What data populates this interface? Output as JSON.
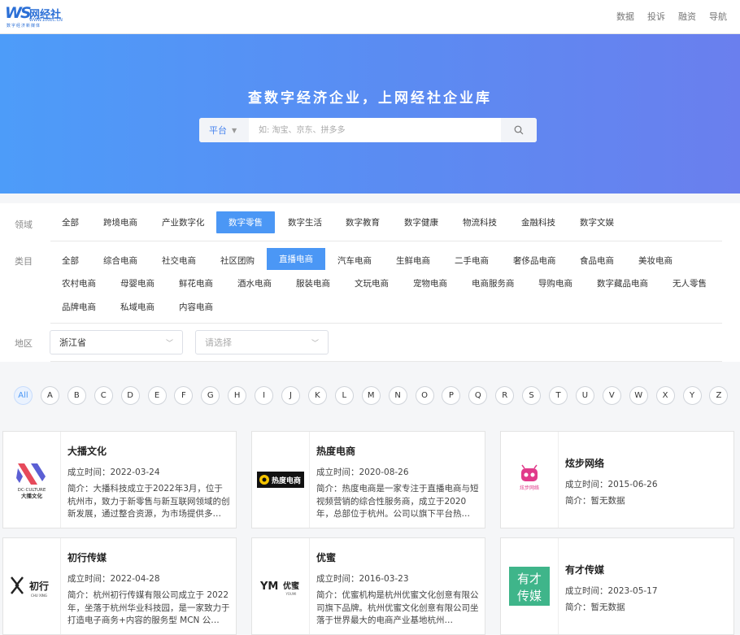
{
  "header": {
    "logo_mark": "WS",
    "logo_name": "网经社",
    "logo_url": "WWW.100EC.CN",
    "logo_tagline": "数字经济新媒体",
    "nav": [
      "数据",
      "投诉",
      "融资",
      "导航"
    ]
  },
  "hero": {
    "title": "查数字经济企业，上网经社企业库",
    "search_select": "平台",
    "search_placeholder": "如: 淘宝、京东、拼多多"
  },
  "filters": {
    "domain_label": "领域",
    "domains": [
      "全部",
      "跨境电商",
      "产业数字化",
      "数字零售",
      "数字生活",
      "数字教育",
      "数字健康",
      "物流科技",
      "金融科技",
      "数字文娱"
    ],
    "domain_active": "数字零售",
    "category_label": "类目",
    "categories": [
      "全部",
      "综合电商",
      "社交电商",
      "社区团购",
      "直播电商",
      "汽车电商",
      "生鲜电商",
      "二手电商",
      "奢侈品电商",
      "食品电商",
      "美妆电商",
      "农村电商",
      "母婴电商",
      "鲜花电商",
      "酒水电商",
      "服装电商",
      "文玩电商",
      "宠物电商",
      "电商服务商",
      "导购电商",
      "数字藏品电商",
      "无人零售",
      "品牌电商",
      "私域电商",
      "内容电商"
    ],
    "category_active": "直播电商",
    "region_label": "地区",
    "province_value": "浙江省",
    "city_placeholder": "请选择"
  },
  "alphabet": {
    "letters": [
      "All",
      "A",
      "B",
      "C",
      "D",
      "E",
      "F",
      "G",
      "H",
      "I",
      "J",
      "K",
      "L",
      "M",
      "N",
      "O",
      "P",
      "Q",
      "R",
      "S",
      "T",
      "U",
      "V",
      "W",
      "X",
      "Y",
      "Z"
    ],
    "active": "All"
  },
  "companies": [
    {
      "name": "大播文化",
      "date": "成立时间：2022-03-24",
      "intro": "简介：大播科技成立于2022年3月，位于杭州市，致力于新零售与新互联网领域的创新发展，通过整合资源，为市场提供多…",
      "logo_text": "DC·CULTURE",
      "logo_sub": "大播文化"
    },
    {
      "name": "热度电商",
      "date": "成立时间：2020-08-26",
      "intro": "简介：热度电商是一家专注于直播电商与短视频营销的综合性服务商，成立于2020年，总部位于杭州。公司以旗下平台热…",
      "logo_text": "热度电商"
    },
    {
      "name": "炫步网络",
      "date": "成立时间：2015-06-26",
      "intro": "简介：暂无数据",
      "logo_text": "炫步网络"
    },
    {
      "name": "初行传媒",
      "date": "成立时间：2022-04-28",
      "intro": "简介：杭州初行传媒有限公司成立于 2022 年，坐落于杭州华业科技园，是一家致力于打造电子商务+内容的服务型 MCN 公…",
      "logo_text": "初行",
      "logo_sub": "CHU XING"
    },
    {
      "name": "优蜜",
      "date": "成立时间：2016-03-23",
      "intro": "简介：优蜜机构是杭州优蜜文化创意有限公司旗下品牌。杭州优蜜文化创意有限公司坐落于世界最大的电商产业基地杭州…",
      "logo_text": "优蜜",
      "logo_sub": "YOUMI"
    },
    {
      "name": "有才传媒",
      "date": "成立时间：2023-05-17",
      "intro": "简介：暂无数据",
      "logo_text": "有才",
      "logo_sub": "传媒"
    }
  ],
  "colors": {
    "accent": "#4b97f5",
    "hero_start": "#4d9cf9",
    "hero_end": "#6a7fee"
  }
}
